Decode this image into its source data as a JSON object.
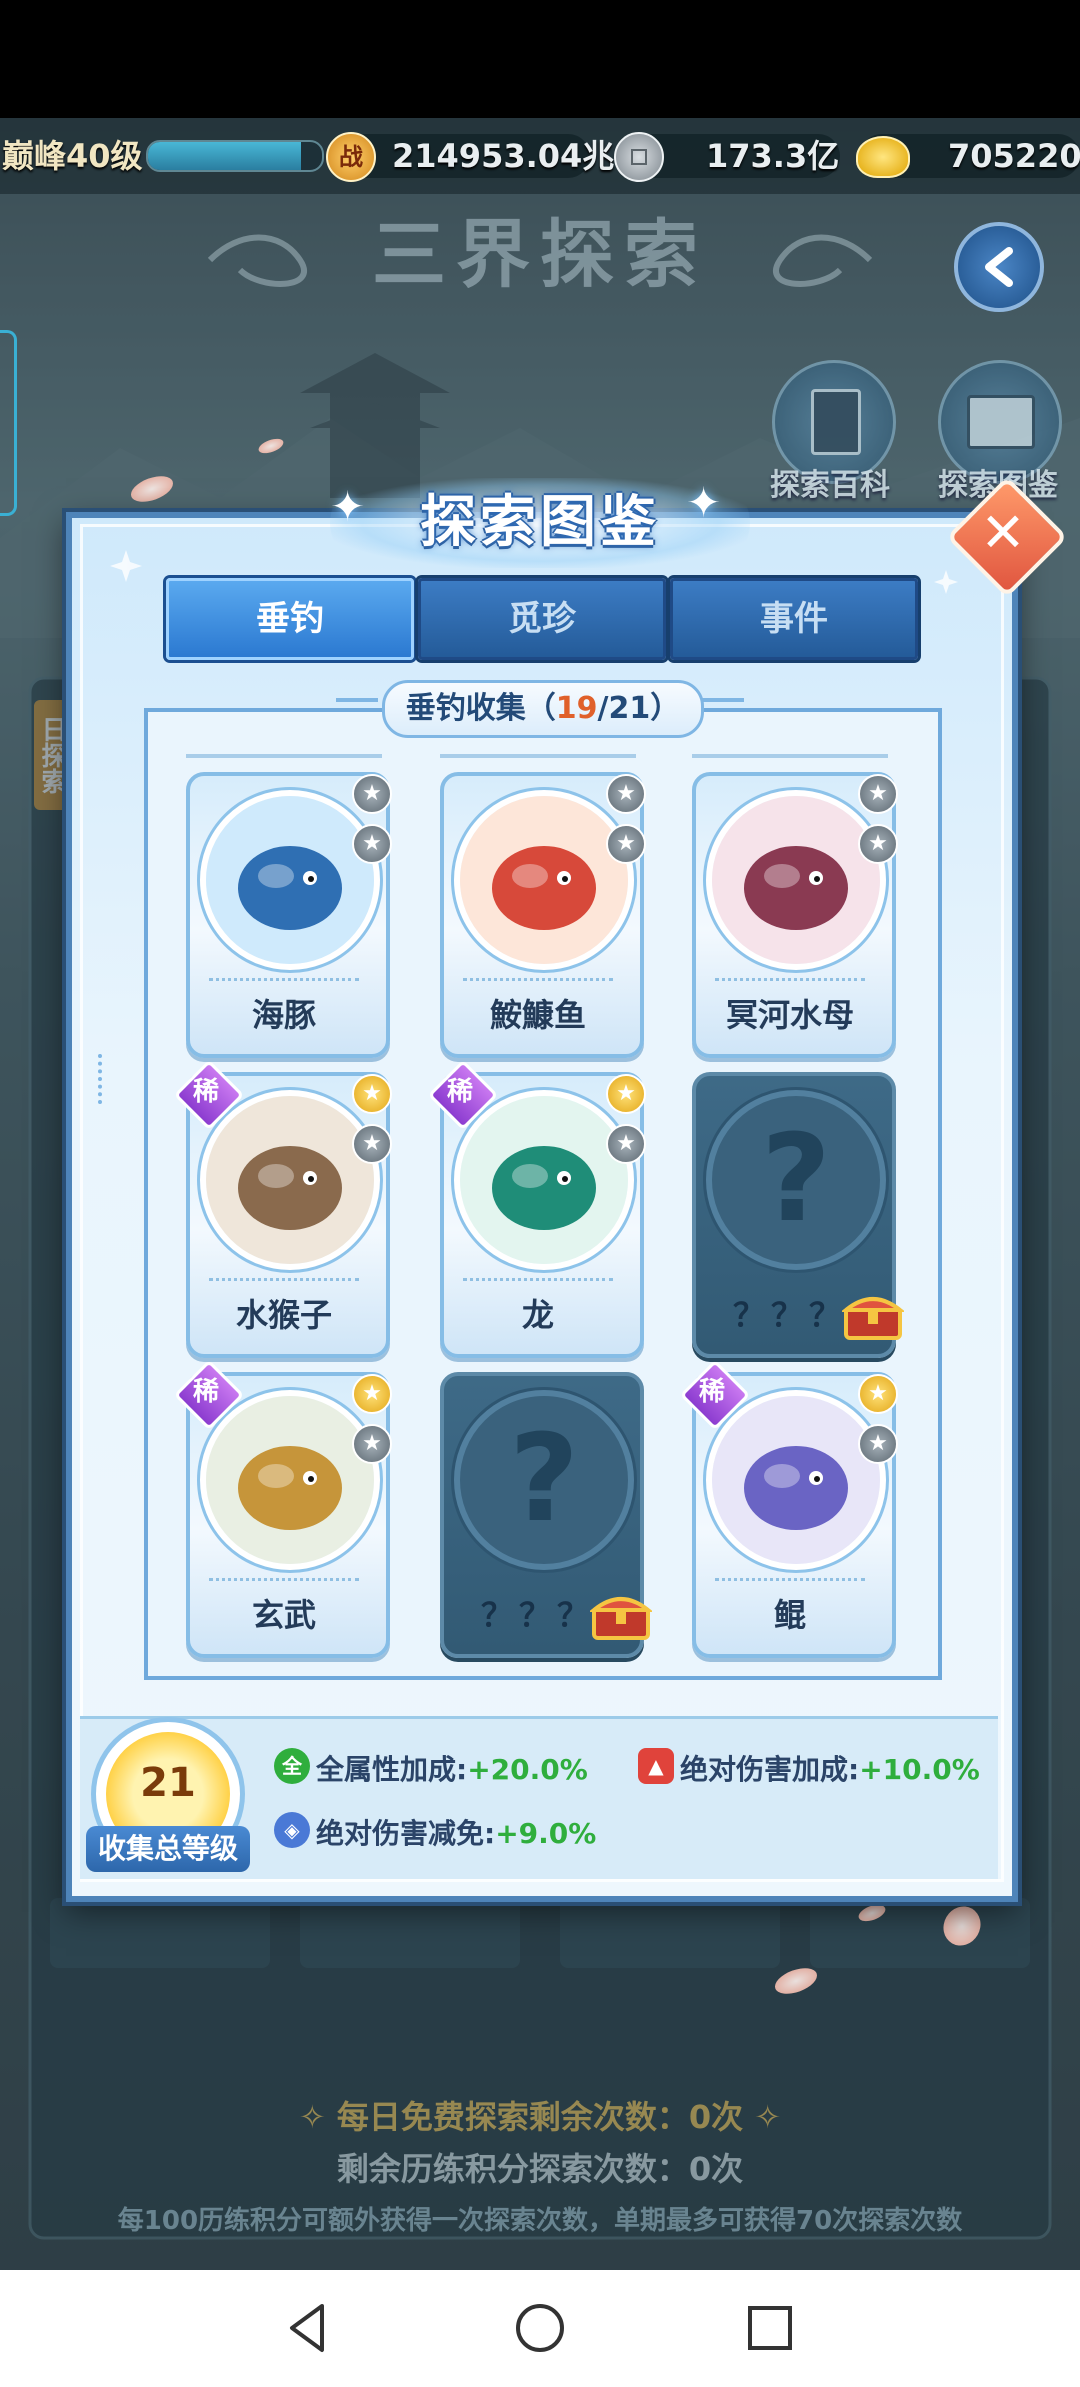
{
  "resources": {
    "level_label": "巅峰40级",
    "exp_fraction": 0.88,
    "power_value": "214953.04兆",
    "copper_value": "173.3亿",
    "gold_value": "705220"
  },
  "scene": {
    "title": "三界探索",
    "side_buttons": [
      "探索百科",
      "探索图鉴"
    ],
    "bg_hints": {
      "daily_free": "每日免费探索剩余次数：0次",
      "exp_points": "剩余历练积分探索次数：0次",
      "rule": "每100历练积分可额外获得一次探索次数，单期最多可获得70次探索次数"
    },
    "left_tab_text": "日探索"
  },
  "modal": {
    "title": "探索图鉴",
    "tabs": [
      "垂钓",
      "觅珍",
      "事件"
    ],
    "active_tab": 0,
    "collection_label": "垂钓收集（",
    "collection_count": "19",
    "collection_total": "/21）",
    "cards": [
      {
        "name": "海豚",
        "rare": false,
        "locked": false,
        "medal_top": "grey",
        "icon": "dolphin-icon"
      },
      {
        "name": "鮟鱇鱼",
        "rare": false,
        "locked": false,
        "medal_top": "grey",
        "icon": "anglerfish-icon"
      },
      {
        "name": "冥河水母",
        "rare": false,
        "locked": false,
        "medal_top": "grey",
        "icon": "jellyfish-icon"
      },
      {
        "name": "水猴子",
        "rare": true,
        "rare_label": "稀",
        "locked": false,
        "medal_top": "gold",
        "icon": "water-monkey-icon"
      },
      {
        "name": "龙",
        "rare": true,
        "rare_label": "稀",
        "locked": false,
        "medal_top": "gold",
        "icon": "dragon-icon"
      },
      {
        "name": "？？？",
        "rare": false,
        "locked": true,
        "icon": "unknown-icon"
      },
      {
        "name": "玄武",
        "rare": true,
        "rare_label": "稀",
        "locked": false,
        "medal_top": "gold",
        "icon": "xuanwu-icon"
      },
      {
        "name": "？？？",
        "rare": false,
        "locked": true,
        "icon": "unknown-icon"
      },
      {
        "name": "鲲",
        "rare": true,
        "rare_label": "稀",
        "locked": false,
        "medal_top": "gold",
        "icon": "kun-whale-icon"
      }
    ],
    "collection_level": {
      "value": "21",
      "label": "收集总等级"
    },
    "stats": [
      {
        "icon_text": "全",
        "label": "全属性加成:",
        "value": "+20.0%",
        "color": "#2fae3d"
      },
      {
        "icon_text": "",
        "label": "绝对伤害加成:",
        "value": "+10.0%",
        "color": "#e0433b"
      },
      {
        "icon_text": "",
        "label": "绝对伤害减免:",
        "value": "+9.0%",
        "color": "#4a79d6"
      }
    ]
  }
}
